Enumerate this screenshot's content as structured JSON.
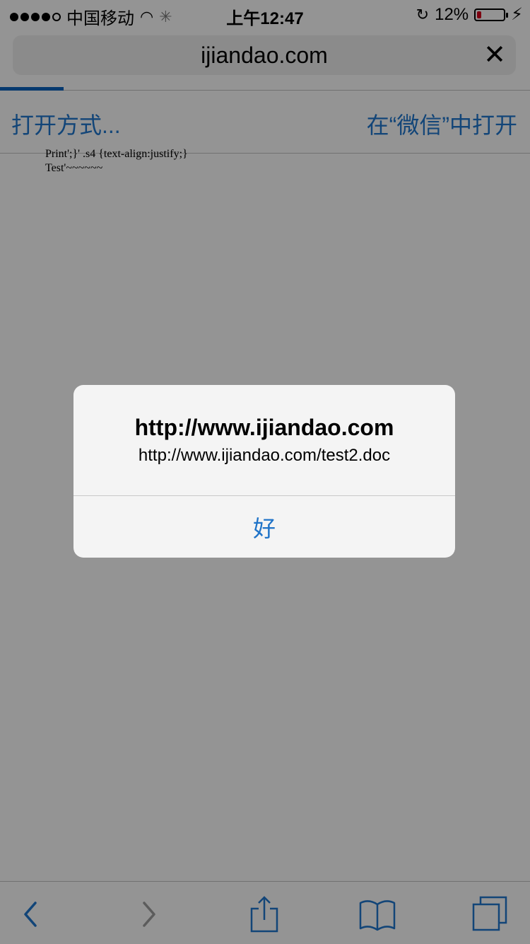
{
  "status_bar": {
    "carrier": "中国移动",
    "time": "上午12:47",
    "battery_percent": "12%",
    "battery_level": 0.12
  },
  "browser": {
    "url": "ijiandao.com",
    "progress": 0.12
  },
  "open_bar": {
    "left_label": "打开方式...",
    "right_label": "在“微信”中打开"
  },
  "document": {
    "line1": "Print';}' .s4 {text-align:justify;}",
    "line2": "Test'~~~~~~"
  },
  "alert": {
    "title": "http://www.ijiandao.com",
    "message": "http://www.ijiandao.com/test2.doc",
    "button_label": "好"
  },
  "toolbar": {
    "icons": [
      "back-icon",
      "forward-icon",
      "share-icon",
      "bookmarks-icon",
      "tabs-icon"
    ]
  },
  "colors": {
    "accent": "#1f73c8",
    "overlay": "rgba(0,0,0,0.4)"
  }
}
